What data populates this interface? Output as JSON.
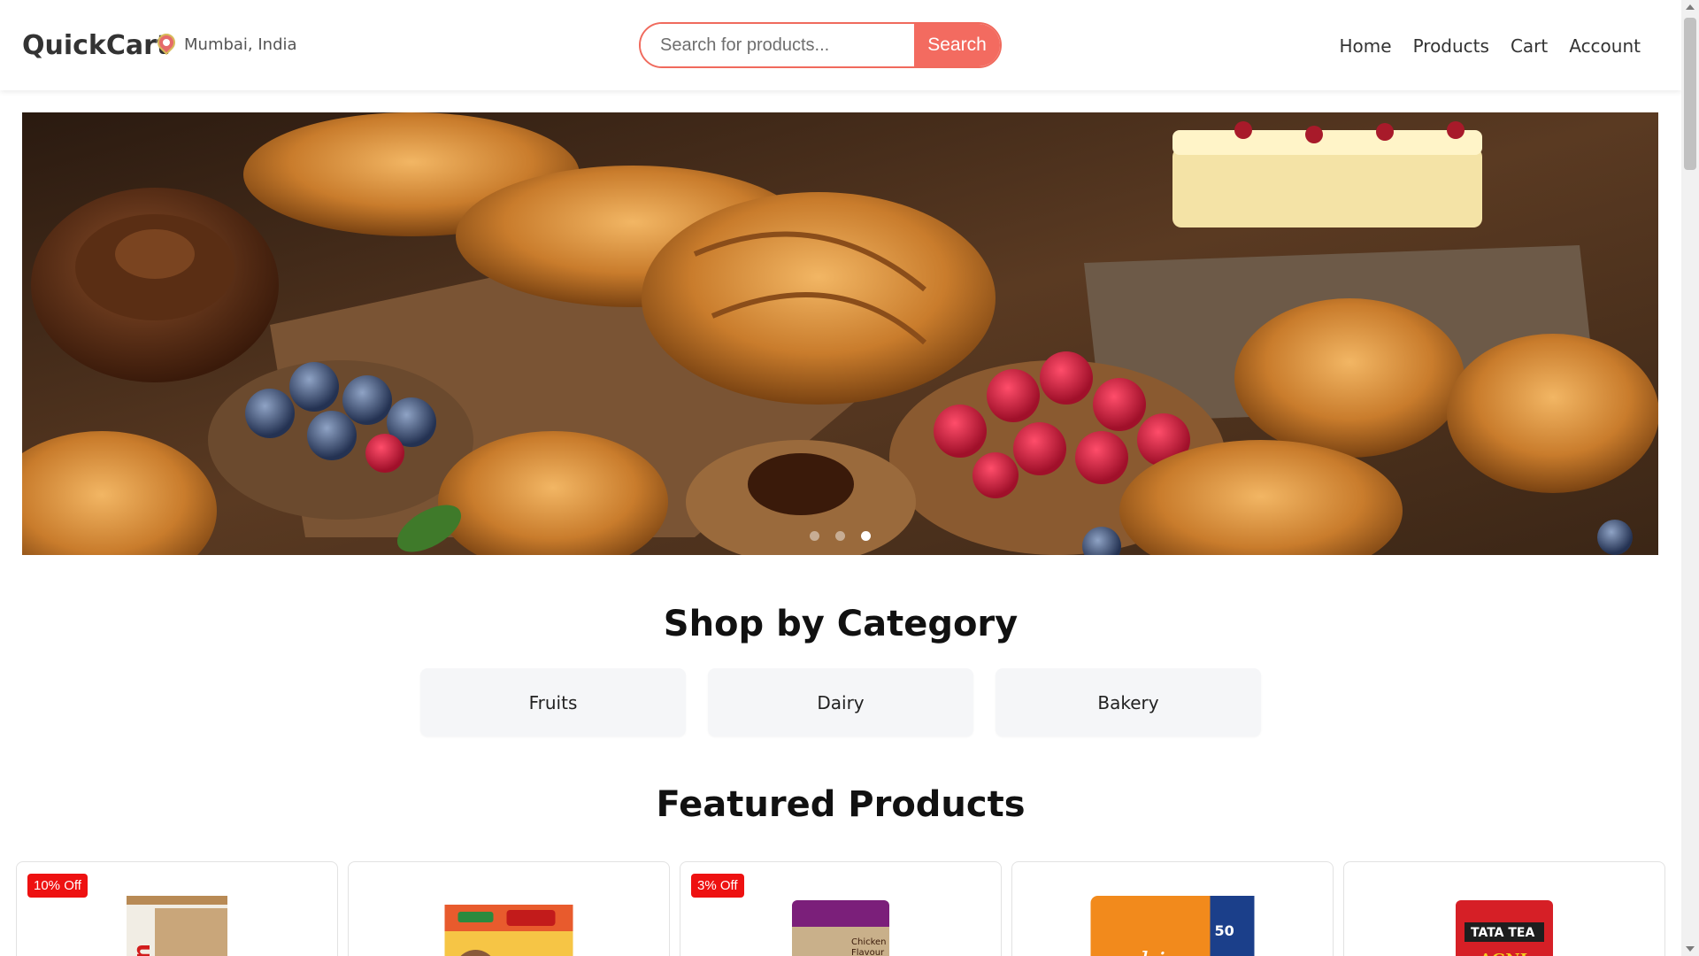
{
  "header": {
    "brand": "QuickCart",
    "location": "Mumbai, India",
    "search_placeholder": "Search for products...",
    "search_button": "Search",
    "nav": [
      "Home",
      "Products",
      "Cart",
      "Account"
    ]
  },
  "banner": {
    "image": "bakery-pastries-berries",
    "slides_total": 3,
    "active_slide": 3
  },
  "categories": {
    "title": "Shop by Category",
    "items": [
      "Fruits",
      "Dairy",
      "Bakery"
    ]
  },
  "featured": {
    "title": "Featured Products",
    "products": [
      {
        "badge": "10% Off",
        "image": "chips-can-product"
      },
      {
        "badge": "",
        "image": "parle-biscuit-pack"
      },
      {
        "badge": "3% Off",
        "image": "chicken-flavour-pack"
      },
      {
        "badge": "",
        "image": "whisper-xl-pack"
      },
      {
        "badge": "",
        "image": "tata-tea-agni-pack"
      }
    ]
  },
  "colors": {
    "accent": "#f36b60",
    "badge": "#ee1111",
    "category_bg": "#f5f6f8"
  }
}
